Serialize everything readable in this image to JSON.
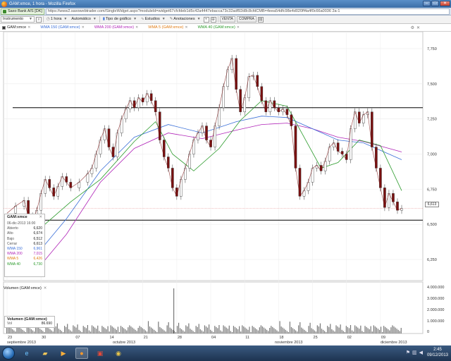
{
  "window": {
    "title": "GAM:xmce, 1 hora - Mozilla Firefox",
    "site_badge": "Saxo Bank A/S [DK]",
    "url": "https://www2.saxowebtrader.com/SingleWidget.aspx?moduleId=widget67cfcfdeb1d5c42a4447ebacca73c32adf92d8c8cfdCMB=4eea54dfc98e4d020ff4a4f0c66a0036 2a-1"
  },
  "toolbar": {
    "instrument_label": "Instrumento",
    "interval_label": "1 hora",
    "automatic_label": "Automático",
    "chart_type_label": "Tipo de gráfico",
    "studies_label": "Estudios",
    "annotations_label": "Anotaciones",
    "sell_label": "VENTA",
    "buy_label": "COMPRA"
  },
  "legend": {
    "items": [
      {
        "label": "GAM:xmce",
        "color": "#333333"
      },
      {
        "label": "WMA 150 (GAM:xmce)",
        "color": "#3a6fd8"
      },
      {
        "label": "WMA 200 (GAM:xmce)",
        "color": "#b024b8"
      },
      {
        "label": "WMA 5 (GAM:xmce)",
        "color": "#e07a10"
      },
      {
        "label": "WMA 40 (GAM:xmce)",
        "color": "#2a9a2a"
      }
    ]
  },
  "infobox": {
    "title": "GAM:xmce",
    "date": "06-dic-2013 16:00",
    "rows": [
      {
        "label": "Abierto",
        "value": "6,620"
      },
      {
        "label": "Alto",
        "value": "6,674"
      },
      {
        "label": "Bajo",
        "value": "6,512"
      },
      {
        "label": "Cerrar",
        "value": "6,613"
      },
      {
        "label": "WMA 150",
        "value": "6,961"
      },
      {
        "label": "WMA 200",
        "value": "7,015"
      },
      {
        "label": "WMA 5",
        "value": "6,426"
      },
      {
        "label": "WMA 40",
        "value": "6,730"
      }
    ]
  },
  "volume": {
    "label": "Volumen (GAM:xmce)",
    "box_title": "Volumen (GAM:xmce)",
    "vol_label": "Vol",
    "vol_value": "86.690"
  },
  "last_price": "6,613",
  "taskbar": {
    "time": "2:45",
    "date": "09/12/2013"
  },
  "colors": {
    "price": "#7a1010",
    "wma150": "#3a6fd8",
    "wma200": "#b024b8",
    "wma5": "#e07a10",
    "wma40": "#2a9a2a",
    "trendline": "#000000"
  },
  "chart_data": {
    "type": "line",
    "y_ticks": [
      "7,750",
      "7,500",
      "7,250",
      "7,000",
      "6,750",
      "6,500",
      "6,250"
    ],
    "ylim": [
      6100,
      7870
    ],
    "volume_ticks": [
      "4.000.000",
      "3.000.000",
      "2.000.000",
      "1.000.000",
      "0"
    ],
    "x_tick_labels": [
      "23",
      "30",
      "07",
      "14",
      "21",
      "28",
      "04",
      "11",
      "18",
      "25",
      "02",
      "09"
    ],
    "x_month_labels": [
      "septiembre 2013",
      "octubre 2013",
      "noviembre 2013",
      "diciembre 2013"
    ],
    "horizontal_lines": [
      7330,
      6530
    ],
    "series": [
      {
        "name": "GAM:xmce",
        "points": [
          [
            0,
            6580
          ],
          [
            2,
            6630
          ],
          [
            4,
            6670
          ],
          [
            5,
            6560
          ],
          [
            6,
            6520
          ],
          [
            7,
            6600
          ],
          [
            8,
            6720
          ],
          [
            9,
            6820
          ],
          [
            10,
            6760
          ],
          [
            11,
            6700
          ],
          [
            12,
            6770
          ],
          [
            13,
            6840
          ],
          [
            14,
            6800
          ],
          [
            15,
            6760
          ],
          [
            17,
            6800
          ],
          [
            19,
            6860
          ],
          [
            20,
            6900
          ],
          [
            21,
            7000
          ],
          [
            22,
            7100
          ],
          [
            23,
            7180
          ],
          [
            24,
            7050
          ],
          [
            25,
            6980
          ],
          [
            26,
            7150
          ],
          [
            27,
            7250
          ],
          [
            28,
            7320
          ],
          [
            29,
            7380
          ],
          [
            30,
            7330
          ],
          [
            31,
            7400
          ],
          [
            32,
            7370
          ],
          [
            33,
            7430
          ],
          [
            34,
            7380
          ],
          [
            35,
            7300
          ],
          [
            36,
            7100
          ],
          [
            37,
            6980
          ],
          [
            38,
            6900
          ],
          [
            39,
            6760
          ],
          [
            40,
            6700
          ],
          [
            41,
            6820
          ],
          [
            42,
            6900
          ],
          [
            43,
            7000
          ],
          [
            44,
            7100
          ],
          [
            45,
            7150
          ],
          [
            46,
            7200
          ],
          [
            47,
            7100
          ],
          [
            48,
            7050
          ],
          [
            49,
            7200
          ],
          [
            50,
            7330
          ],
          [
            51,
            7480
          ],
          [
            52,
            7600
          ],
          [
            53,
            7680
          ],
          [
            54,
            7460
          ],
          [
            55,
            7300
          ],
          [
            56,
            7400
          ],
          [
            57,
            7550
          ],
          [
            58,
            7560
          ],
          [
            59,
            7480
          ],
          [
            60,
            7380
          ],
          [
            61,
            7300
          ],
          [
            62,
            7380
          ],
          [
            63,
            7330
          ],
          [
            64,
            7300
          ],
          [
            65,
            7320
          ],
          [
            66,
            7280
          ],
          [
            67,
            7200
          ],
          [
            68,
            6900
          ],
          [
            69,
            6700
          ],
          [
            70,
            6740
          ],
          [
            71,
            6800
          ],
          [
            72,
            6900
          ],
          [
            73,
            6920
          ],
          [
            74,
            6880
          ],
          [
            75,
            6950
          ],
          [
            76,
            7050
          ],
          [
            77,
            7080
          ],
          [
            78,
            7020
          ],
          [
            79,
            7000
          ],
          [
            80,
            6960
          ],
          [
            81,
            7180
          ],
          [
            82,
            7300
          ],
          [
            83,
            7220
          ],
          [
            84,
            7280
          ],
          [
            85,
            7300
          ],
          [
            86,
            7050
          ],
          [
            87,
            6900
          ],
          [
            88,
            6760
          ],
          [
            89,
            6620
          ],
          [
            90,
            6720
          ],
          [
            91,
            6660
          ],
          [
            92,
            6600
          ],
          [
            93,
            6613
          ]
        ]
      },
      {
        "name": "WMA 40 (GAM:xmce)",
        "points": [
          [
            7,
            6450
          ],
          [
            15,
            6660
          ],
          [
            22,
            6820
          ],
          [
            30,
            7090
          ],
          [
            35,
            7230
          ],
          [
            39,
            7000
          ],
          [
            44,
            6880
          ],
          [
            50,
            7040
          ],
          [
            55,
            7240
          ],
          [
            60,
            7380
          ],
          [
            66,
            7340
          ],
          [
            70,
            7120
          ],
          [
            74,
            6900
          ],
          [
            78,
            6940
          ],
          [
            83,
            7100
          ],
          [
            88,
            7060
          ],
          [
            93,
            6740
          ]
        ]
      },
      {
        "name": "WMA 150 (GAM:xmce)",
        "points": [
          [
            6,
            6250
          ],
          [
            14,
            6540
          ],
          [
            22,
            6880
          ],
          [
            30,
            7120
          ],
          [
            38,
            7210
          ],
          [
            46,
            7150
          ],
          [
            54,
            7230
          ],
          [
            60,
            7270
          ],
          [
            66,
            7260
          ],
          [
            72,
            7180
          ],
          [
            78,
            7100
          ],
          [
            84,
            7080
          ],
          [
            90,
            7000
          ],
          [
            93,
            6960
          ]
        ]
      },
      {
        "name": "WMA 200 (GAM:xmce)",
        "points": [
          [
            6,
            6140
          ],
          [
            14,
            6430
          ],
          [
            22,
            6800
          ],
          [
            30,
            7040
          ],
          [
            38,
            7150
          ],
          [
            46,
            7110
          ],
          [
            54,
            7170
          ],
          [
            60,
            7210
          ],
          [
            66,
            7220
          ],
          [
            72,
            7180
          ],
          [
            78,
            7120
          ],
          [
            84,
            7090
          ],
          [
            90,
            7040
          ],
          [
            93,
            7015
          ]
        ]
      }
    ]
  }
}
